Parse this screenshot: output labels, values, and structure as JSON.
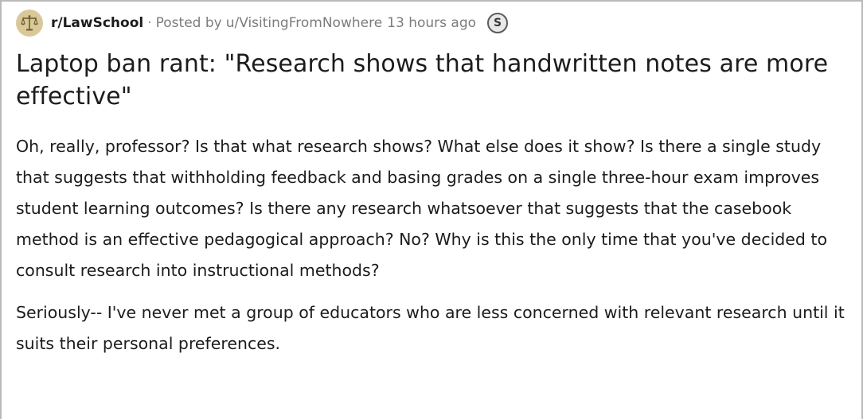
{
  "post": {
    "subreddit": "r/LawSchool",
    "separator": "·",
    "posted_by_label": "Posted by",
    "author": "u/VisitingFromNowhere",
    "time": "13 hours ago",
    "award_icon": "silver-award-icon",
    "award_glyph": "S",
    "subreddit_icon": "scales-of-justice-icon",
    "title": "Laptop ban rant: \"Research shows that handwritten notes are more effective\"",
    "paragraphs": [
      "Oh, really, professor? Is that what research shows? What else does it show? Is there a single study that suggests that withholding feedback and basing grades on a single three-hour exam improves student learning outcomes? Is there any research whatsoever that suggests that the casebook method is an effective pedagogical approach? No? Why is this the only time that you've decided to consult research into instructional methods?",
      "Seriously-- I've never met a group of educators who are less concerned with relevant research until it suits their personal preferences."
    ]
  },
  "colors": {
    "border": "#b9b9b9",
    "text": "#1c1c1c",
    "meta_text": "#7c7c7c",
    "avatar_bg": "#d9c99a"
  }
}
